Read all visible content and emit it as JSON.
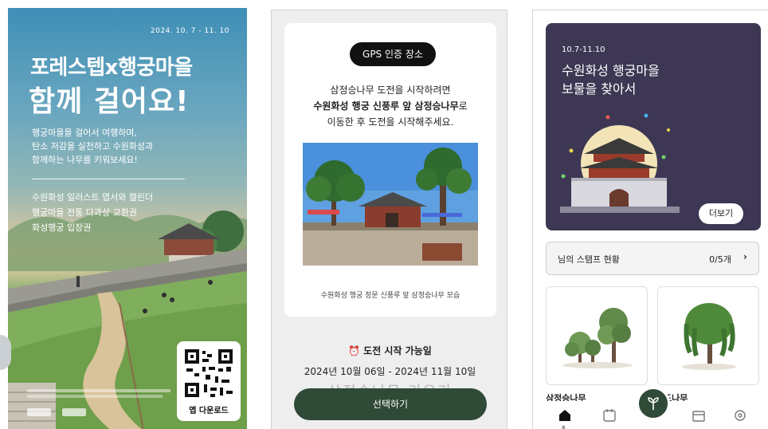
{
  "poster": {
    "date": "2024. 10. 7 - 11. 10",
    "title_line1": "포레스텝x행궁마을",
    "title_line2": "함께 걸어요!",
    "description": [
      "행궁마을을 걸어서 여행하며,",
      "탄소 저감을 실천하고 수원화성과",
      "함께하는 나무를 키워보세요!"
    ],
    "benefits": [
      "수원화성 일러스트 엽서와 캘린더",
      "행궁마을 전통 다과상 교환권",
      "화성행궁 입장권"
    ],
    "qr_label": "앱 다운로드"
  },
  "mission": {
    "gps_badge": "GPS 인증 장소",
    "line1": "삼정승나무 도전을 시작하려면",
    "line2_bold": "수원화성 행궁 신풍루 앞 삼정승나무",
    "line2_tail": "로",
    "line3": "이동한 후 도전을 시작해주세요.",
    "photo_caption": "수원화성 행궁 정문 신풍루 앞 삼정승나무 모습",
    "available_label": "도전 시작 가능일",
    "period": "2024년 10월 06일 - 2024년 11월 10일",
    "ghost_text": "삼정승나무 키우기",
    "select_button": "선택하기"
  },
  "home": {
    "banner_date": "10.7-11.10",
    "banner_title": [
      "수원화성 행궁마을",
      "보물을 찾아서"
    ],
    "more_button": "더보기",
    "stamp_label": "님의 스탬프 현황",
    "stamp_count": "0/5개",
    "trees": [
      {
        "name": "삼정승나무"
      },
      {
        "name": "드나무"
      }
    ],
    "tabs": [
      "home-icon",
      "calendar-icon",
      "sprout-icon",
      "store-icon",
      "settings-icon"
    ],
    "active_tab_label": "홈"
  },
  "colors": {
    "dark_green": "#2f4a36",
    "banner_purple": "#3d3754",
    "gps_black": "#111111"
  }
}
